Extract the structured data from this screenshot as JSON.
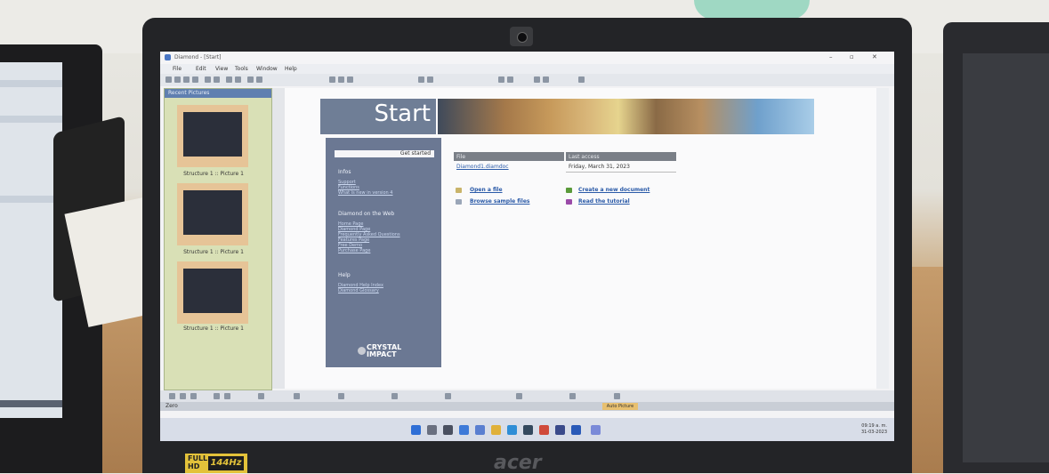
{
  "window": {
    "title": "Diamond - [Start]",
    "menu": [
      "File",
      "Edit",
      "View",
      "Tools",
      "Window",
      "Help"
    ]
  },
  "recent_pictures": {
    "title": "Recent Pictures",
    "items": [
      {
        "caption": "Structure 1 :: Picture 1"
      },
      {
        "caption": "Structure 1 :: Picture 1"
      },
      {
        "caption": "Structure 1 :: Picture 1"
      }
    ]
  },
  "start_page": {
    "heading": "Start",
    "get_started": "Get started",
    "sections": [
      {
        "title": "Infos",
        "links": [
          "Support",
          "Functions",
          "What is new in version 4"
        ]
      },
      {
        "title": "Diamond on the Web",
        "links": [
          "Home Page",
          "Diamond Page",
          "Frequently Asked Questions",
          "Features Page",
          "Free Demo",
          "Purchase Page"
        ]
      },
      {
        "title": "Help",
        "links": [
          "Diamond Help Index",
          "Diamond Glossary"
        ]
      }
    ],
    "vendor_logo": "CRYSTAL IMPACT",
    "table": {
      "columns": [
        "File",
        "Last access"
      ],
      "rows": [
        {
          "file": "Diamond1.diamdoc",
          "last_access": "Friday, March 31, 2023"
        }
      ]
    },
    "actions": [
      {
        "label": "Open a file",
        "icon": "folder-icon"
      },
      {
        "label": "Create a new document",
        "icon": "new-document-icon"
      },
      {
        "label": "Browse sample files",
        "icon": "sample-files-icon"
      },
      {
        "label": "Read the tutorial",
        "icon": "tutorial-icon"
      }
    ]
  },
  "status_bar": {
    "left": "Zero",
    "mode": "Auto Picture"
  },
  "taskbar": {
    "time": "09:19 a. m.",
    "date": "31-03-2023"
  },
  "laptop": {
    "brand": "acer",
    "sticker_top": "FULL",
    "sticker_mid": "HD",
    "sticker_hz": "144Hz"
  }
}
